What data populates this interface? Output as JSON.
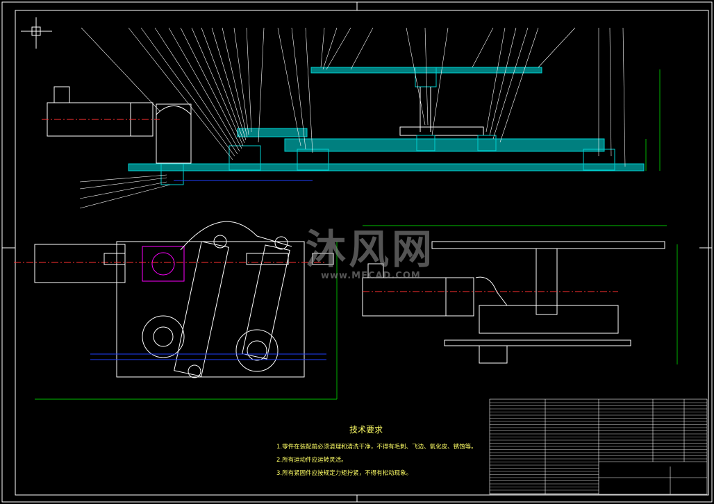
{
  "watermark": {
    "brand": "沐风网",
    "url": "www.MFCAD.COM"
  },
  "technical_requirements": {
    "title": "技术要求",
    "notes": [
      "1.零件在装配前必须清理和清洗干净，不得有毛刺、飞边、氧化皮、锈蚀等。",
      "2.所有运动件应运转灵活。",
      "3.所有紧固件应按规定力矩拧紧，不得有松动现象。"
    ]
  },
  "colors": {
    "background": "#000000",
    "outline": "#ffffff",
    "section_hatch": "#00c8c8",
    "center_line": "#ff3030",
    "dimension": "#00ff00",
    "fastener": "#ff00ff",
    "axis_blue": "#2040ff",
    "note_text": "#ffff66"
  }
}
